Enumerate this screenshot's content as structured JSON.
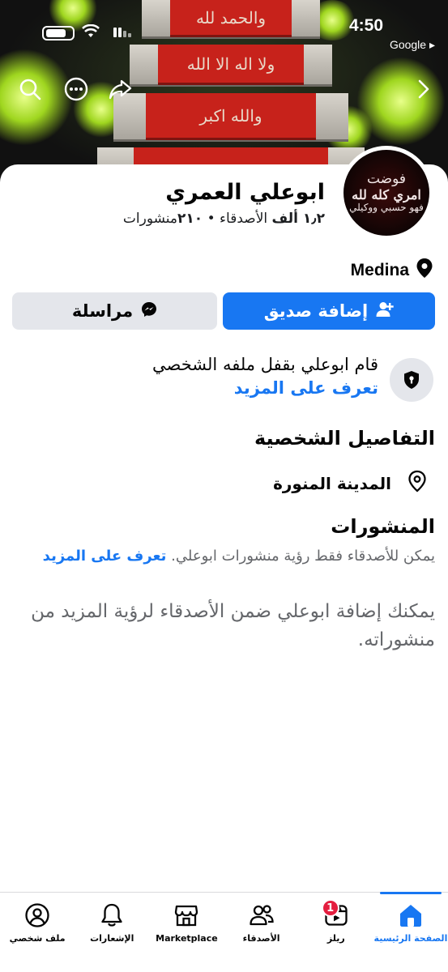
{
  "status_bar": {
    "time": "4:50",
    "back_app": "Google ▸"
  },
  "cover": {
    "carpet_lines": [
      "والحمد لله",
      "ولا اله الا الله",
      "والله اكبر"
    ]
  },
  "avatar": {
    "line1": "فوضت",
    "line2": "امري كله لله",
    "line3": "فهو حسبي ووكيلي"
  },
  "profile": {
    "name": "ابوعلي العمري",
    "friends_count": "١٫٢ ألف",
    "friends_label": "الأصدقاء",
    "posts_count": "٢١٠",
    "posts_label": "منشورات",
    "location": "Medina"
  },
  "actions": {
    "add_friend": "إضافة صديق",
    "message": "مراسلة"
  },
  "lock_notice": {
    "text": "قام ابوعلي بقفل ملفه الشخصي",
    "learn_more": "تعرف على المزيد"
  },
  "details": {
    "title": "التفاصيل الشخصية",
    "city": "المدينة المنورة"
  },
  "posts": {
    "title": "المنشورات",
    "note": "يمكن للأصدقاء فقط رؤية منشورات ابوعلي.",
    "learn_more": "تعرف على المزيد",
    "add_note": "يمكنك إضافة ابوعلي ضمن الأصدقاء لرؤية المزيد من منشوراته."
  },
  "bottom_nav": {
    "home": "الصفحة الرئيسية",
    "reels": "ريلز",
    "reels_badge": "1",
    "friends": "الأصدقاء",
    "marketplace": "Marketplace",
    "notifications": "الإشعارات",
    "profile": "ملف شخصي"
  },
  "colors": {
    "accent": "#1877f2",
    "badge": "#e41e3f",
    "secondary_button": "#e4e6eb",
    "muted_text": "#65676b"
  },
  "icons": [
    "search-icon",
    "more-icon",
    "share-icon",
    "forward-icon",
    "location-pin-icon",
    "add-friend-icon",
    "messenger-icon",
    "shield-lock-icon",
    "home-icon",
    "reels-icon",
    "friends-icon",
    "marketplace-icon",
    "bell-icon",
    "profile-icon"
  ]
}
